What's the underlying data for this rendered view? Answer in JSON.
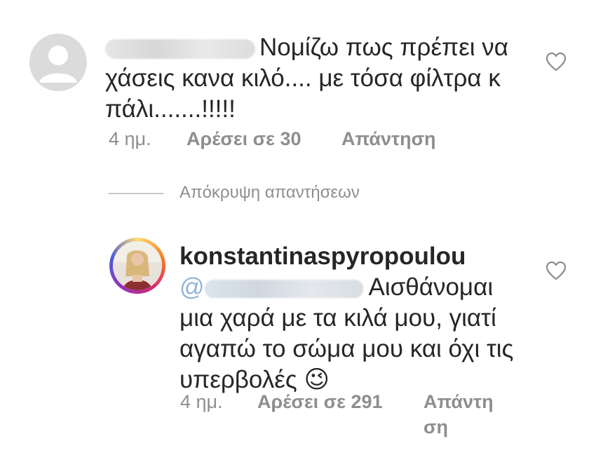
{
  "comments": [
    {
      "avatar": "default-avatar",
      "text_line1": "Νομίζω πως πρέπει να",
      "text_line2": "χάσεις κανα κιλό.... με τόσα φίλτρα κ",
      "text_line3": "πάλι.......!!!!!",
      "time": "4 ημ.",
      "likes": "Αρέσει σε 30",
      "reply": "Απάντηση",
      "like_icon": "heart-outline-icon"
    }
  ],
  "hide_replies": "Απόκρυψη απαντήσεων",
  "reply": {
    "username": "konstantinaspyropoulou",
    "mention_prefix": "@",
    "text_line1": "Αισθάνομαι",
    "text_line2": "μια χαρά με τα κιλά μου, γιατί",
    "text_line3": "αγαπώ το σώμα μου και όχι τις",
    "text_line4": "υπερβολές",
    "emoji": "😉",
    "time": "4 ημ.",
    "likes": "Αρέσει σε 291",
    "reply_line1": "Απάντη",
    "reply_line2": "ση",
    "like_icon": "heart-outline-icon"
  }
}
